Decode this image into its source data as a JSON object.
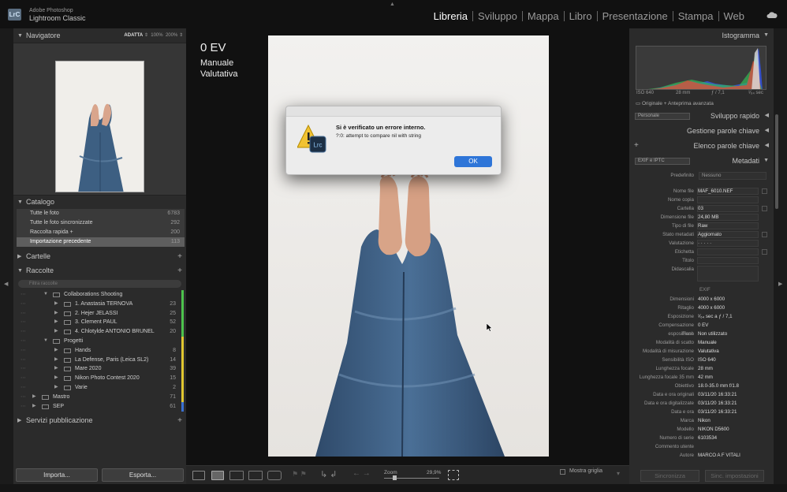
{
  "app": {
    "brand_top": "Adobe Photoshop",
    "brand_name": "Lightroom Classic",
    "logo": "LrC"
  },
  "modules": [
    "Libreria",
    "Sviluppo",
    "Mappa",
    "Libro",
    "Presentazione",
    "Stampa",
    "Web"
  ],
  "active_module": "Libreria",
  "navigator": {
    "title": "Navigatore",
    "zoom_fit": "ADATTA",
    "zoom_100": "100%",
    "zoom_200": "200%"
  },
  "catalog": {
    "title": "Catalogo",
    "items": [
      {
        "label": "Tutte le foto",
        "count": "6783"
      },
      {
        "label": "Tutte le foto sincronizzate",
        "count": "292"
      },
      {
        "label": "Raccolta rapida +",
        "count": "200"
      },
      {
        "label": "Importazione precedente",
        "count": "113",
        "selected": true
      }
    ]
  },
  "folders": {
    "title": "Cartelle"
  },
  "collections": {
    "title": "Raccolte",
    "search_placeholder": "Filtra raccolte",
    "items": [
      {
        "label": "Collaborations Shooting",
        "count": "",
        "depth": 1,
        "color": "#4cc24c",
        "set": true
      },
      {
        "label": "1. Anastasia TERNOVA",
        "count": "23",
        "depth": 2,
        "color": "#4cc24c"
      },
      {
        "label": "2. Hejer JELASSI",
        "count": "25",
        "depth": 2,
        "color": "#4cc24c"
      },
      {
        "label": "3. Clement PAUL",
        "count": "52",
        "depth": 2,
        "color": "#4cc24c"
      },
      {
        "label": "4. Chlotylde ANTONIO BRUNEL",
        "count": "20",
        "depth": 2,
        "color": "#4cc24c"
      },
      {
        "label": "Progetti",
        "count": "",
        "depth": 1,
        "color": "#e0c630",
        "set": true
      },
      {
        "label": "Hands",
        "count": "8",
        "depth": 2,
        "color": "#e0c630"
      },
      {
        "label": "La Defense, Paris (Leica SL2)",
        "count": "14",
        "depth": 2,
        "color": "#e0c630"
      },
      {
        "label": "Mare 2020",
        "count": "39",
        "depth": 2,
        "color": "#e0c630"
      },
      {
        "label": "Nikon Photo Contest 2020",
        "count": "15",
        "depth": 2,
        "color": "#e0c630"
      },
      {
        "label": "Varie",
        "count": "2",
        "depth": 2,
        "color": "#e0c630"
      },
      {
        "label": "Mastro",
        "count": "71",
        "depth": 0,
        "color": "#e0c630"
      },
      {
        "label": "SEP",
        "count": "61",
        "depth": 0,
        "color": "#3a6fd0"
      }
    ]
  },
  "publish": {
    "title": "Servizi pubblicazione"
  },
  "left_buttons": {
    "import": "Importa...",
    "export": "Esporta..."
  },
  "overlay": {
    "ev": "0 EV",
    "mode": "Manuale",
    "metering": "Valutativa"
  },
  "dialog": {
    "title": "Si è verificato un errore interno.",
    "message": "?:0: attempt to compare nil with string",
    "ok": "OK",
    "icon_text": "Lrc"
  },
  "toolbar": {
    "zoom_label": "Zoom",
    "zoom_value": "29,9%",
    "grid_label": "Mostra griglia",
    "zoom_level": 0.17
  },
  "histogram": {
    "title": "Istogramma",
    "iso": "ISO 640",
    "focal": "28 mm",
    "aperture": "ƒ / 7,1",
    "shutter": "¹⁄₆₄ sec",
    "original_preview": "Originale + Anteprima avanzata"
  },
  "quick_develop": {
    "preset": "Personale",
    "title": "Sviluppo rapido"
  },
  "keywording": {
    "title": "Gestione parole chiave"
  },
  "keyword_list": {
    "title": "Elenco parole chiave"
  },
  "metadata": {
    "title": "Metadati",
    "preset_select": "EXIF e IPTC",
    "preset_label": "Predefinito",
    "preset_value": "Nessuno",
    "rows": [
      {
        "k": "Nome file",
        "v": "MAF_6010.NEF"
      },
      {
        "k": "Nome copia",
        "v": ""
      },
      {
        "k": "Cartella",
        "v": "03"
      },
      {
        "k": "Dimensione file",
        "v": "24,80 MB"
      },
      {
        "k": "Tipo di file",
        "v": "Raw"
      },
      {
        "k": "Stato metadati",
        "v": "Aggiornato"
      },
      {
        "k": "Valutazione",
        "v": "·  ·  ·  ·  ·"
      },
      {
        "k": "Etichetta",
        "v": ""
      },
      {
        "k": "Titolo",
        "v": ""
      },
      {
        "k": "Didascalia",
        "v": ""
      }
    ],
    "exif_header": "EXIF",
    "exif": [
      {
        "k": "Dimensioni",
        "v": "4000 x 6000"
      },
      {
        "k": "Ritaglio",
        "v": "4000 x 6000"
      },
      {
        "k": "Esposizione",
        "v": "¹⁄₆₄ sec a ƒ / 7,1"
      },
      {
        "k": "Compensazione esposizione",
        "v": "0 EV"
      },
      {
        "k": "Flash",
        "v": "Non utilizzato"
      },
      {
        "k": "Modalità di scatto",
        "v": "Manuale"
      },
      {
        "k": "Modalità di misurazione",
        "v": "Valutativa"
      },
      {
        "k": "Sensibilità ISO",
        "v": "ISO 640"
      },
      {
        "k": "Lunghezza focale",
        "v": "28 mm"
      },
      {
        "k": "Lunghezza focale 35 mm",
        "v": "42 mm"
      },
      {
        "k": "Obiettivo",
        "v": "18.0-35.0 mm f/1.8"
      },
      {
        "k": "Data e ora originali",
        "v": "03/11/20 16:33:21"
      },
      {
        "k": "Data e ora digitalizzate",
        "v": "03/11/20 16:33:21"
      },
      {
        "k": "Data e ora",
        "v": "03/11/20 16:33:21"
      },
      {
        "k": "Marca",
        "v": "Nikon"
      },
      {
        "k": "Modello",
        "v": "NIKON D5600"
      },
      {
        "k": "Numero di serie",
        "v": "6103534"
      },
      {
        "k": "Commento utente",
        "v": ""
      },
      {
        "k": "Autore",
        "v": "MARCO A F VITALI"
      }
    ]
  },
  "right_buttons": {
    "sync": "Sincronizza",
    "sync_settings": "Sinc. impostazioni"
  }
}
